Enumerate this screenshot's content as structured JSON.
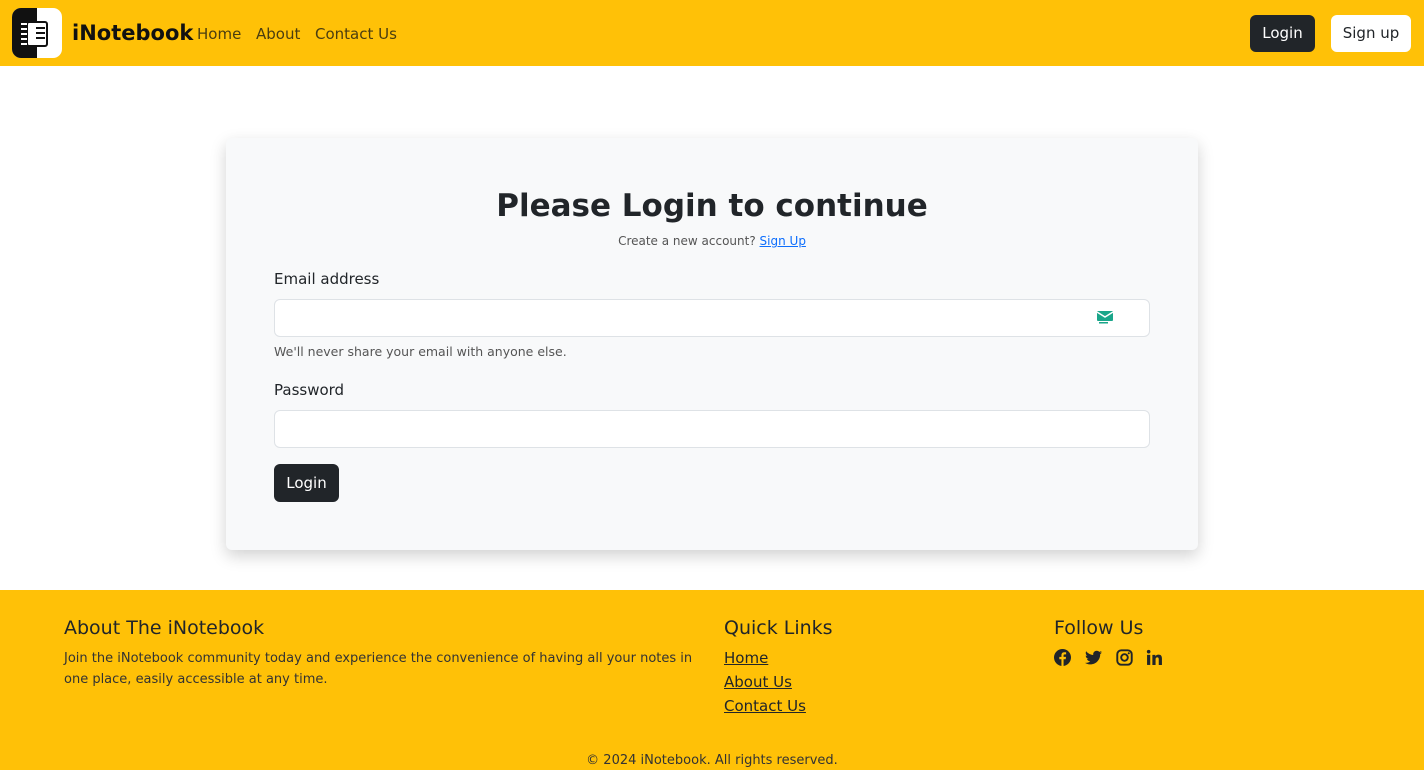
{
  "navbar": {
    "brand": "iNotebook",
    "links": [
      "Home",
      "About",
      "Contact Us"
    ],
    "login_label": "Login",
    "signup_label": "Sign up"
  },
  "login_card": {
    "title": "Please Login to continue",
    "subtitle_text": "Create a new account?",
    "subtitle_link": "Sign Up",
    "email_label": "Email address",
    "email_value": "",
    "email_help": "We'll never share your email with anyone else.",
    "password_label": "Password",
    "password_value": "",
    "submit_label": "Login"
  },
  "footer": {
    "about_heading": "About The iNotebook",
    "about_text": "Join the iNotebook community today and experience the convenience of having all your notes in one place, easily accessible at any time.",
    "links_heading": "Quick Links",
    "links": [
      "Home",
      "About Us",
      "Contact Us"
    ],
    "follow_heading": "Follow Us",
    "social_icons": [
      "facebook-icon",
      "twitter-icon",
      "instagram-icon",
      "linkedin-icon"
    ],
    "copyright": "© 2024 iNotebook. All rights reserved."
  },
  "colors": {
    "primary": "#ffc107",
    "dark": "#212529",
    "link": "#0d6efd"
  }
}
